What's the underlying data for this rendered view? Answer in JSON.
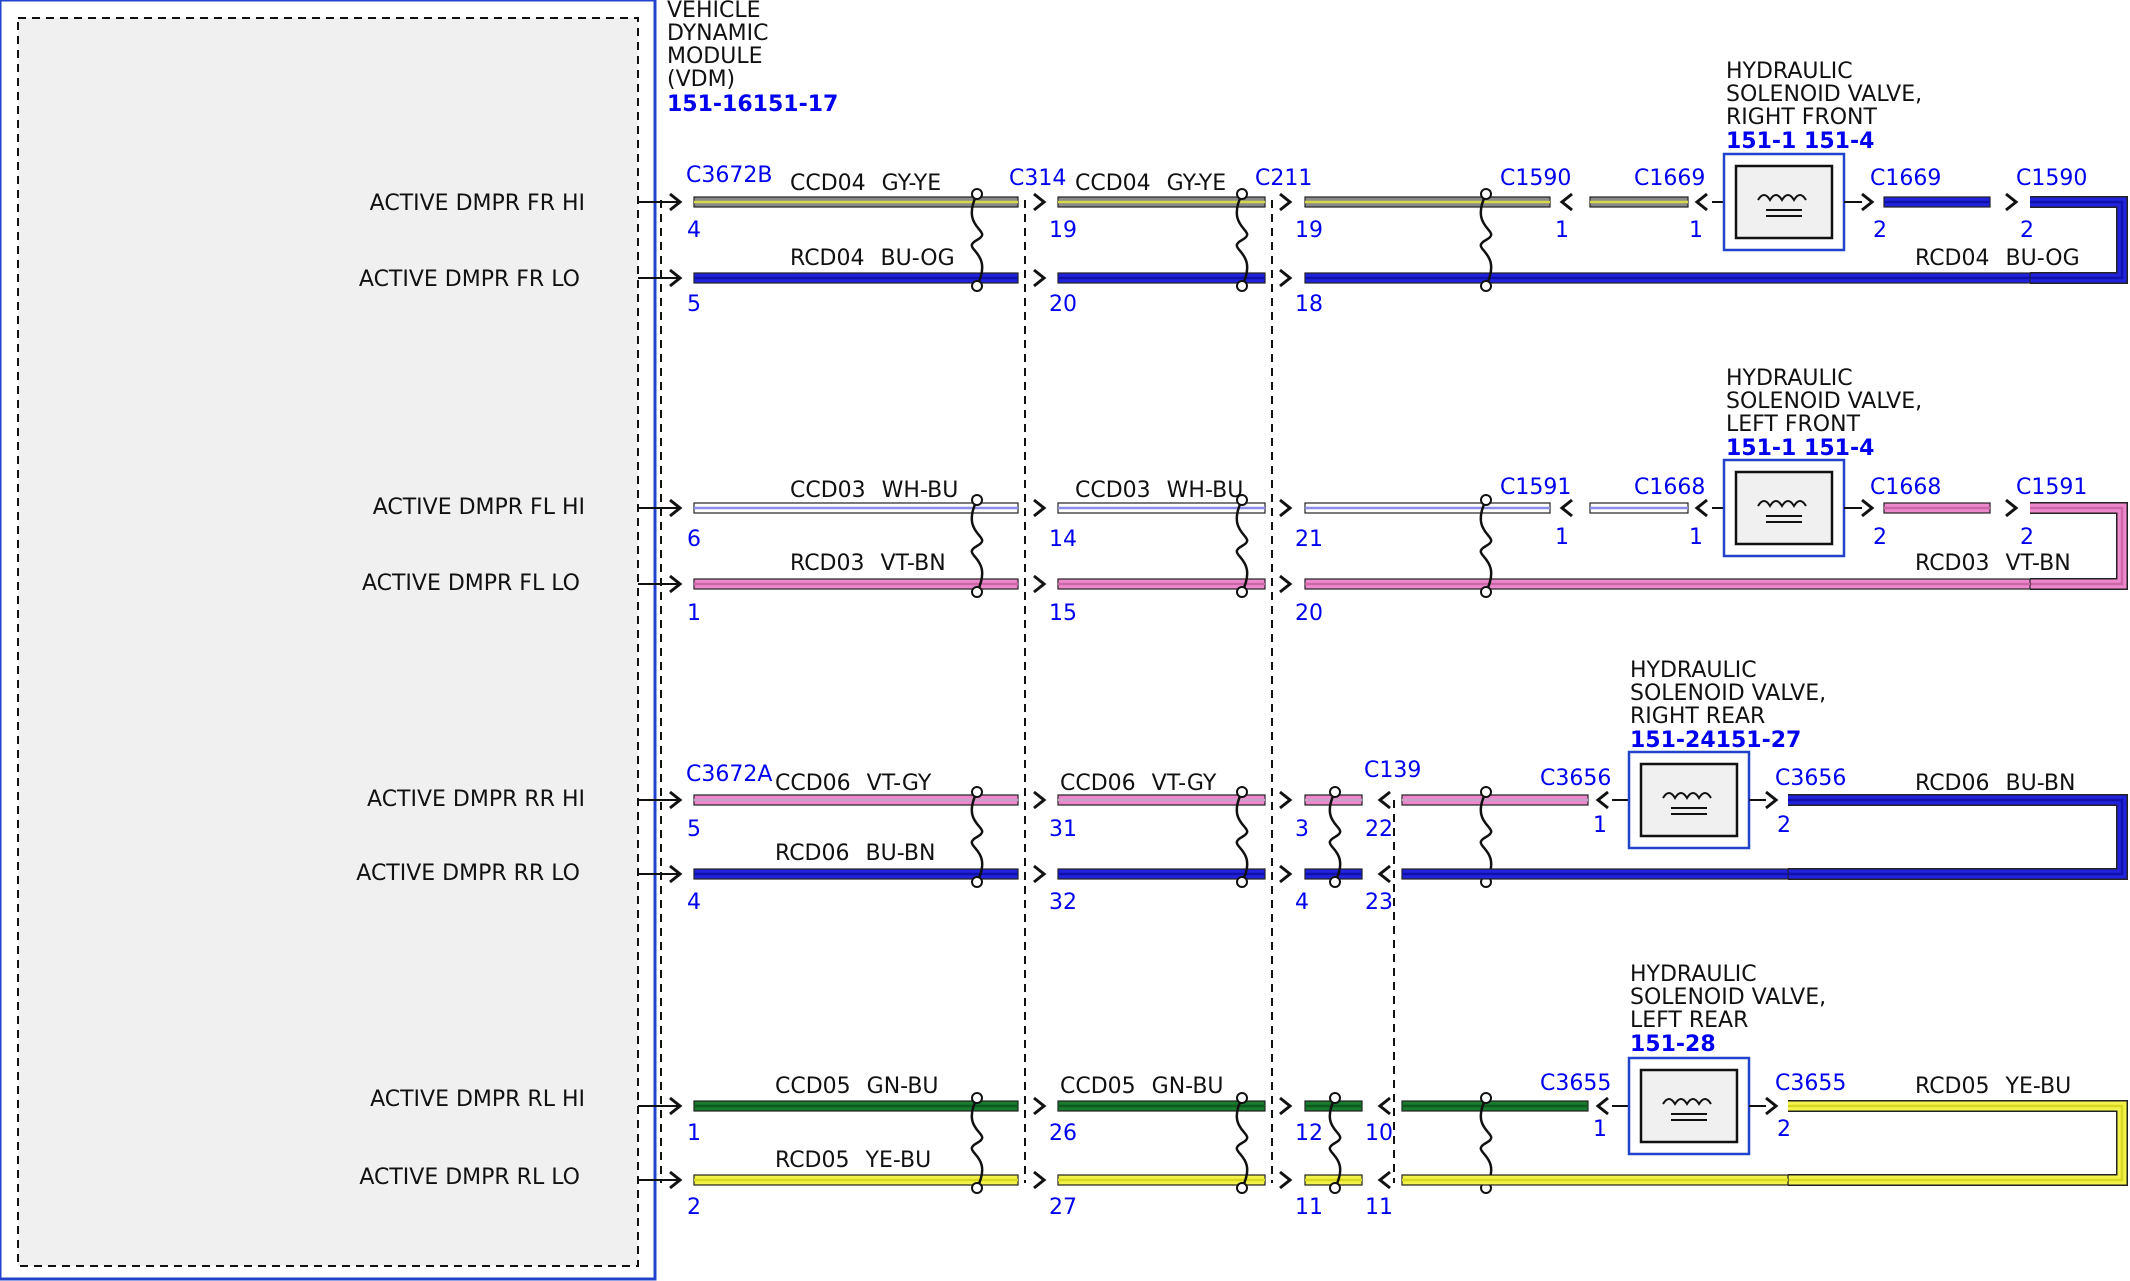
{
  "colors": {
    "GY-YE": [
      "#8a8a8a",
      "#d6d94a"
    ],
    "BU-OG": [
      "#2222dd",
      "#1010aa"
    ],
    "WH-BU": [
      "#ffffff",
      "#8b8be8"
    ],
    "VT-BN": [
      "#ee88cc",
      "#cc66aa"
    ],
    "VT-GY": [
      "#ee88cc",
      "#c9a0c9"
    ],
    "BU-BN": [
      "#2222dd",
      "#1010aa"
    ],
    "GN-BU": [
      "#1a7a2e",
      "#0d5a1d"
    ],
    "YE-BU": [
      "#f2f24a",
      "#d8d820"
    ],
    "frame": "#2244cc",
    "module_bg": "#f0f0f0"
  },
  "module": {
    "title_lines": [
      "VEHICLE",
      "DYNAMIC",
      "MODULE",
      "(VDM)"
    ],
    "ref": "151-16151-17"
  },
  "signals": [
    "ACTIVE DMPR FR HI",
    "ACTIVE DMPR FR LO",
    "ACTIVE DMPR FL HI",
    "ACTIVE DMPR FL LO",
    "ACTIVE DMPR RR HI",
    "ACTIVE DMPR RR LO",
    "ACTIVE DMPR RL HI",
    "ACTIVE DMPR RL LO"
  ],
  "groups": [
    {
      "id": "fr",
      "vdm_conn": "C3672B",
      "hi": {
        "circuit": "CCD04",
        "color": "GY-YE",
        "pins": [
          "4",
          "19",
          "19",
          "1",
          "1",
          "2",
          "2"
        ]
      },
      "lo": {
        "circuit": "RCD04",
        "color": "BU-OG",
        "pins": [
          "5",
          "20",
          "18"
        ]
      },
      "conns": [
        "C314",
        "C211",
        "C1590",
        "C1669",
        "C1669",
        "C1590"
      ],
      "valve": {
        "lines": [
          "HYDRAULIC",
          "SOLENOID VALVE,",
          "RIGHT FRONT"
        ],
        "ref": "151-1 151-4"
      }
    },
    {
      "id": "fl",
      "vdm_conn": "",
      "hi": {
        "circuit": "CCD03",
        "color": "WH-BU",
        "pins": [
          "6",
          "14",
          "21",
          "1",
          "1",
          "2",
          "2"
        ]
      },
      "lo": {
        "circuit": "RCD03",
        "color": "VT-BN",
        "pins": [
          "1",
          "15",
          "20"
        ]
      },
      "conns": [
        "",
        "",
        "C1591",
        "C1668",
        "C1668",
        "C1591"
      ],
      "valve": {
        "lines": [
          "HYDRAULIC",
          "SOLENOID VALVE,",
          "LEFT FRONT"
        ],
        "ref": "151-1 151-4"
      }
    },
    {
      "id": "rr",
      "vdm_conn": "C3672A",
      "hi": {
        "circuit": "CCD06",
        "color": "VT-GY",
        "pins": [
          "5",
          "31",
          "3",
          "22",
          "1",
          "2"
        ]
      },
      "lo": {
        "circuit": "RCD06",
        "color": "BU-BN",
        "pins": [
          "4",
          "32",
          "4",
          "23"
        ]
      },
      "conns": [
        "C139",
        "C3656",
        "C3656"
      ],
      "valve": {
        "lines": [
          "HYDRAULIC",
          "SOLENOID VALVE,",
          "RIGHT REAR"
        ],
        "ref": "151-24151-27"
      }
    },
    {
      "id": "rl",
      "vdm_conn": "",
      "hi": {
        "circuit": "CCD05",
        "color": "GN-BU",
        "pins": [
          "1",
          "26",
          "12",
          "10",
          "1",
          "2"
        ]
      },
      "lo": {
        "circuit": "RCD05",
        "color": "YE-BU",
        "pins": [
          "2",
          "27",
          "11",
          "11"
        ]
      },
      "conns": [
        "C3655",
        "C3655"
      ],
      "valve": {
        "lines": [
          "HYDRAULIC",
          "SOLENOID VALVE,",
          "LEFT REAR"
        ],
        "ref": "151-28"
      }
    }
  ]
}
